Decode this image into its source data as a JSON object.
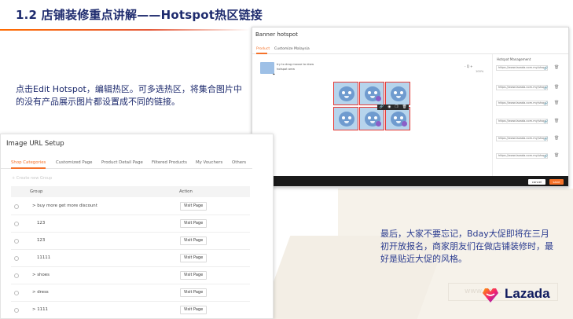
{
  "slide": {
    "title": "1.2  店铺装修重点讲解——Hotspot热区链接",
    "desc_left": "点击Edit Hotspot，编辑热区。可多选热区，将集合图片中的没有产品展示图片都设置成不同的链接。",
    "desc_right": "最后，大家不要忘记，Bday大促即将在三月初开放报名，商家朋友们在做店铺装修时，最好是贴近大促的风格。"
  },
  "banner": {
    "title": "Banner hotspot",
    "tabs": [
      "Product",
      "Customize Malaysia"
    ],
    "thumb_tip": "try to drag mouse to draw hotspot area",
    "zoom": "- Q +",
    "zoom_pct": "100%",
    "hotspot_title": "Hotspot Management",
    "links": [
      "https://www.lazada.com.my/shop/",
      "https://www.lazada.com.my/shop/",
      "https://www.lazada.com.my/shop/",
      "https://www.lazada.com.my/shop/",
      "https://www.lazada.com.my/shop/",
      "https://www.lazada.com.my/shop/"
    ],
    "cancel": "cancel",
    "save": "save"
  },
  "image_url": {
    "title": "Image URL Setup",
    "tabs": [
      "Shop Categories",
      "Customized Page",
      "Product Detail Page",
      "Filtered Products",
      "My Vouchers",
      "Others"
    ],
    "create": "+ Create new Group",
    "col_group": "Group",
    "col_action": "Action",
    "rows": [
      {
        "name": "> buy more get more discount",
        "action": "Visit Page"
      },
      {
        "name": "123",
        "action": "Visit Page"
      },
      {
        "name": "123",
        "action": "Visit Page"
      },
      {
        "name": "11111",
        "action": "Visit Page"
      },
      {
        "name": "> shoes",
        "action": "Visit Page"
      },
      {
        "name": "> dress",
        "action": "Visit Page"
      },
      {
        "name": "> 1111",
        "action": "Visit Page"
      }
    ]
  },
  "brand": {
    "name": "Lazada",
    "watermark": "www.am..."
  },
  "colors": {
    "title": "#1e2b6e",
    "accent": "#f5722a",
    "hotspot_border": "#e53935"
  }
}
